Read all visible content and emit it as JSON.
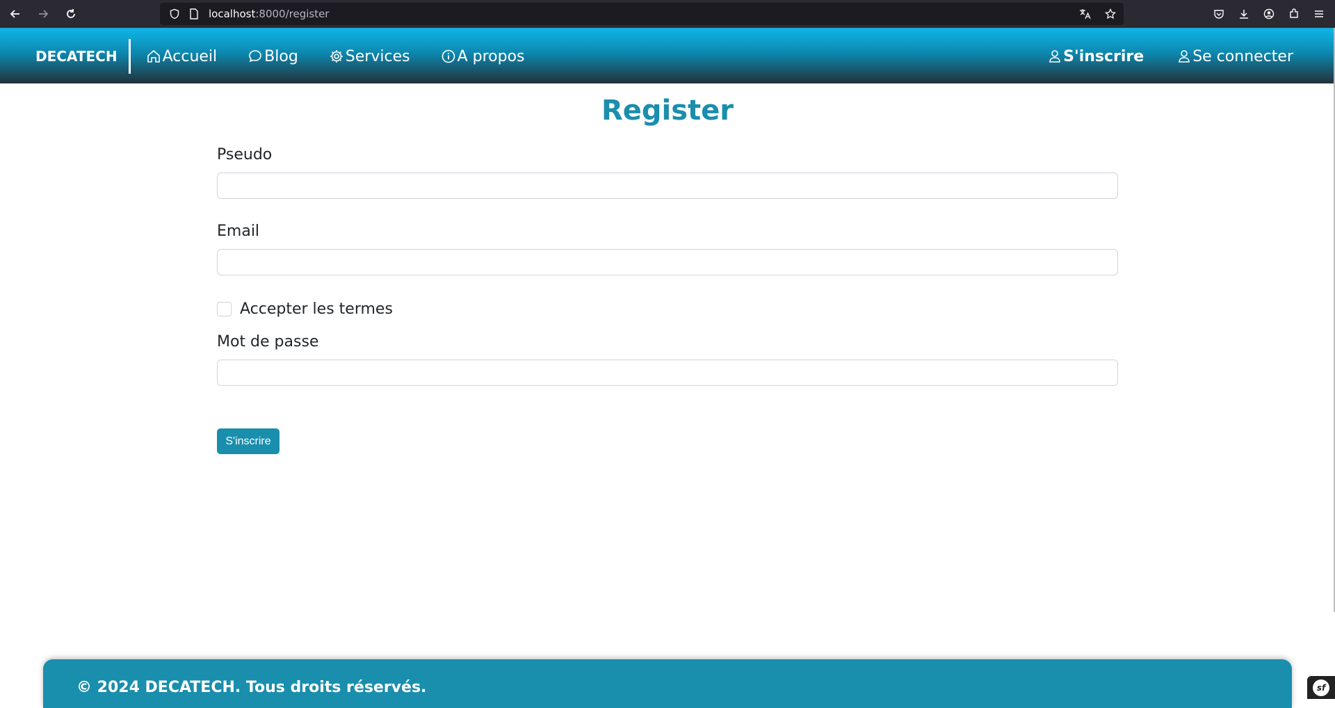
{
  "browser": {
    "url_host": "localhost",
    "url_path": ":8000/register"
  },
  "navbar": {
    "brand": "DECATECH",
    "links": [
      {
        "label": "Accueil",
        "icon": "home-icon"
      },
      {
        "label": "Blog",
        "icon": "chat-bubble-icon"
      },
      {
        "label": "Services",
        "icon": "gear-icon"
      },
      {
        "label": "A propos",
        "icon": "info-icon"
      }
    ],
    "register_label": "S'inscrire",
    "login_label": "Se connecter"
  },
  "form": {
    "title": "Register",
    "pseudo_label": "Pseudo",
    "pseudo_value": "",
    "email_label": "Email",
    "email_value": "",
    "terms_label": "Accepter les termes",
    "terms_checked": false,
    "password_label": "Mot de passe",
    "password_value": "",
    "submit_label": "S'inscrire"
  },
  "footer": {
    "text": "© 2024 DECATECH. Tous droits réservés."
  },
  "debug_badge": {
    "label": "sf"
  },
  "colors": {
    "accent": "#1a8ead",
    "nav_top": "#0fb4e6",
    "nav_bottom": "#223138"
  }
}
